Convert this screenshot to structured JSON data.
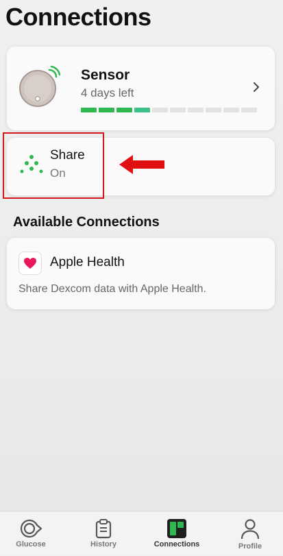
{
  "page": {
    "title": "Connections"
  },
  "sensor": {
    "title": "Sensor",
    "subtitle": "4 days left",
    "progress_segments_filled": 4,
    "progress_segments_total": 10
  },
  "share": {
    "title": "Share",
    "status": "On"
  },
  "available": {
    "section_title": "Available Connections",
    "items": [
      {
        "title": "Apple Health",
        "description": "Share Dexcom data with Apple Health."
      }
    ]
  },
  "tabbar": {
    "tabs": [
      {
        "label": "Glucose",
        "icon": "glucose-icon"
      },
      {
        "label": "History",
        "icon": "history-icon"
      },
      {
        "label": "Connections",
        "icon": "connections-icon",
        "active": true
      },
      {
        "label": "Profile",
        "icon": "profile-icon"
      }
    ]
  },
  "colors": {
    "accent_green": "#2fb84f",
    "annotation_red": "#d7151c",
    "heart_pink": "#e8185a"
  }
}
